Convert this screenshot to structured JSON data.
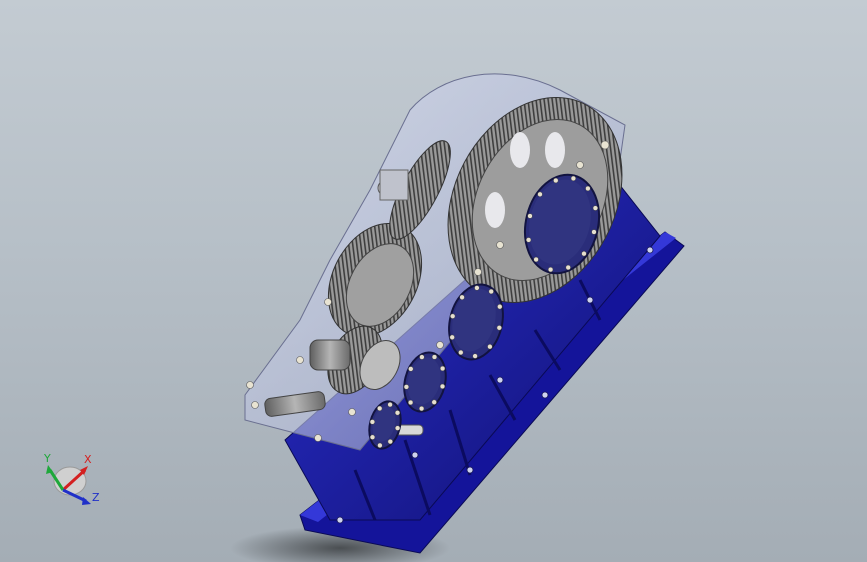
{
  "viewport": {
    "background_top": "#c3cbd2",
    "background_bottom": "#a4adb5"
  },
  "model": {
    "housing_color": "#1d1fa6",
    "housing_dark": "#121380",
    "cover_color": "#b8c0d8",
    "gear_color": "#8c8c8c",
    "flange_color": "#2a2d7a",
    "bolt_color": "#e6e0d0"
  },
  "triad": {
    "x_label": "X",
    "y_label": "Y",
    "z_label": "Z",
    "x_color": "#d42020",
    "y_color": "#1ea83a",
    "z_color": "#2030c8"
  }
}
